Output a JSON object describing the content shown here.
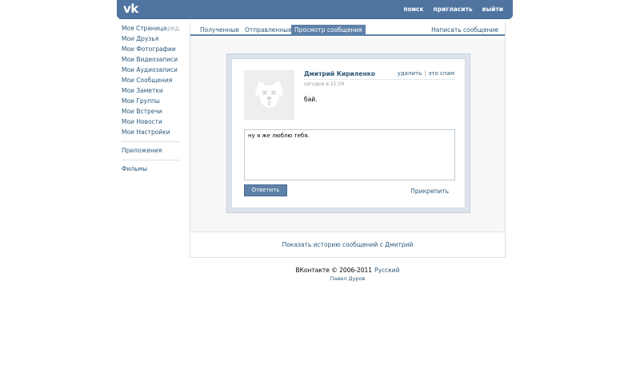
{
  "header": {
    "logo": "vk",
    "nav": [
      "поиск",
      "пригласить",
      "выйти"
    ]
  },
  "sidebar": {
    "items": [
      {
        "label": "Моя Страница",
        "edit": "ред."
      },
      {
        "label": "Мои Друзья"
      },
      {
        "label": "Мои Фотографии"
      },
      {
        "label": "Мои Видеозаписи"
      },
      {
        "label": "Мои Аудиозаписи"
      },
      {
        "label": "Мои Сообщения"
      },
      {
        "label": "Мои Заметки"
      },
      {
        "label": "Мои Группы"
      },
      {
        "label": "Мои Встречи"
      },
      {
        "label": "Мои Новости"
      },
      {
        "label": "Мои Настройки"
      }
    ],
    "extra": [
      "Приложения",
      "Фильмы"
    ]
  },
  "tabs": [
    "Полученные",
    "Отправленные",
    "Просмотр сообщения"
  ],
  "write_link": "Написать сообщение",
  "message": {
    "sender": "Дмитрий Кириленко",
    "actions": [
      "удалить",
      "это спам"
    ],
    "time": "сегодня в 21:59",
    "text": "бай.",
    "reply_value": "ну я же люблю тебя.",
    "reply_button": "Ответить",
    "attach": "Прикрепить"
  },
  "history_link": "Показать историю сообщений с Дмитрий",
  "footer": {
    "copyright": "ВКонтакте © 2006-2011",
    "language": "Русский",
    "author": "Павел Дуров"
  },
  "colors": {
    "header_blue": "#4f74a0",
    "link_blue": "#2b587a",
    "tab_active": "#5e81a8"
  }
}
